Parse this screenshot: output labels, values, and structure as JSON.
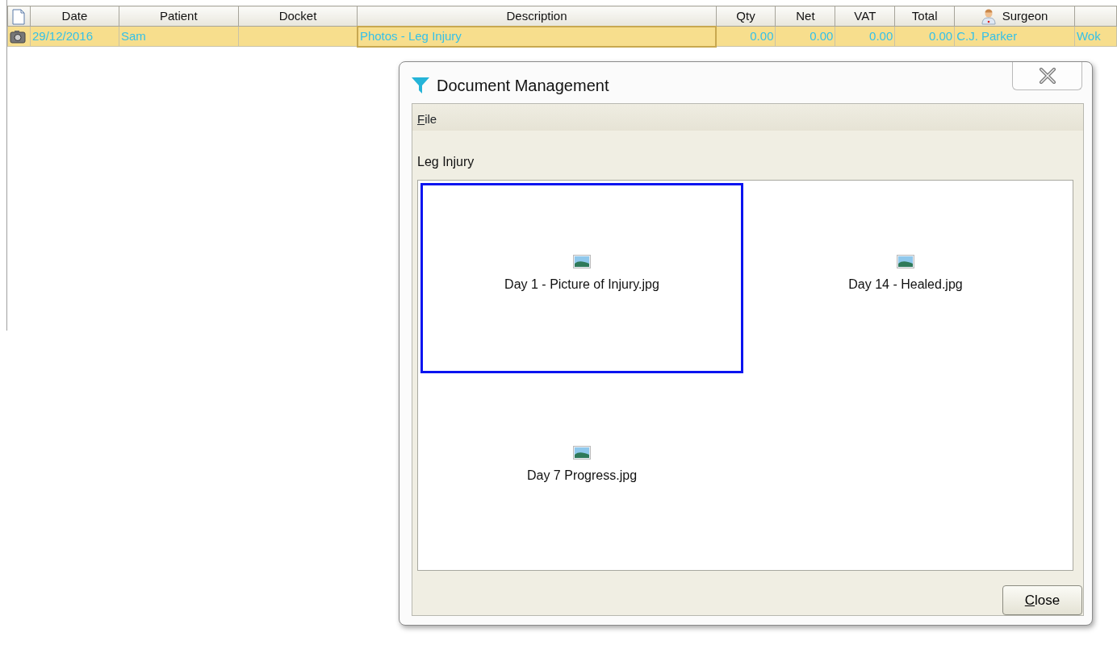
{
  "table": {
    "columns": [
      {
        "kind": "icon"
      },
      {
        "label": "Date",
        "kind": "text"
      },
      {
        "label": "Patient",
        "kind": "text"
      },
      {
        "label": "Docket",
        "kind": "text"
      },
      {
        "label": "Description",
        "kind": "text"
      },
      {
        "label": "Qty",
        "kind": "number"
      },
      {
        "label": "Net",
        "kind": "number"
      },
      {
        "label": "VAT",
        "kind": "number"
      },
      {
        "label": "Total",
        "kind": "number"
      },
      {
        "label": "Surgeon",
        "kind": "person"
      },
      {
        "kind": "text"
      }
    ],
    "rows": [
      {
        "selected": true,
        "cells": [
          {
            "focused": false
          },
          {
            "text": "29/12/2016",
            "focused": false
          },
          {
            "text": "Sam",
            "focused": false
          },
          {
            "focused": false
          },
          {
            "text": "Photos - Leg Injury",
            "focused": true
          },
          {
            "text": "0.00",
            "focused": false
          },
          {
            "text": "0.00",
            "focused": false
          },
          {
            "text": "0.00",
            "focused": false
          },
          {
            "text": "0.00",
            "focused": false
          },
          {
            "text": "C.J. Parker",
            "focused": false
          },
          {
            "text": "Wok",
            "focused": false
          }
        ]
      }
    ]
  },
  "dialog": {
    "title": "Document Management",
    "menu": [
      "File"
    ],
    "folder_label": "Leg Injury",
    "files": [
      {
        "label": "Day 1 - Picture of Injury.jpg",
        "selected": true
      },
      {
        "label": "Day 14 - Healed.jpg",
        "selected": false
      },
      {
        "label": "Day 7 Progress.jpg",
        "selected": false
      }
    ],
    "buttons": [
      "Close"
    ]
  }
}
